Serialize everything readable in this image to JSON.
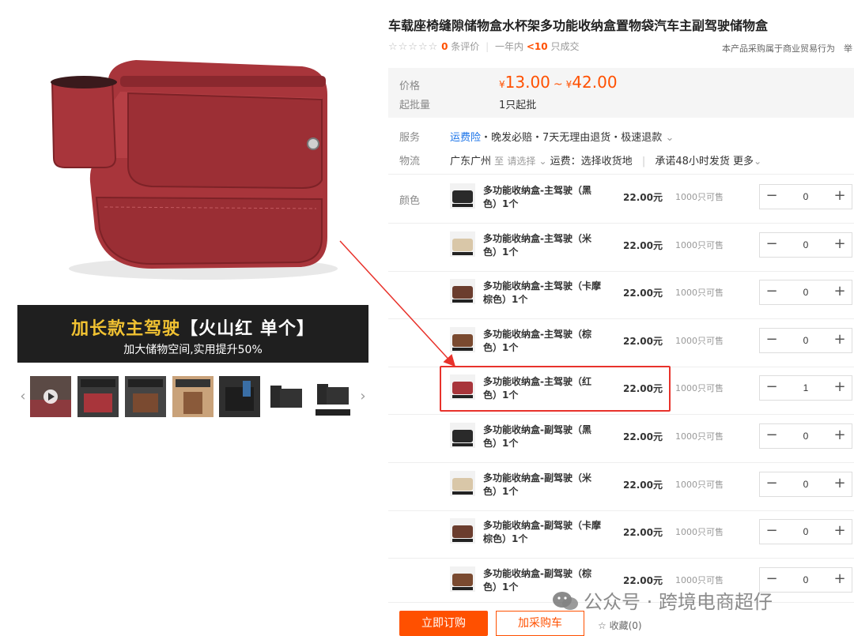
{
  "gallery": {
    "banner_title_main": "加长款主驾驶",
    "banner_title_tag": "【火山红 单个】",
    "banner_subtitle": "加大储物空间,实用提升50%",
    "thumb_prev_icon": "chevron-left-icon",
    "thumb_next_icon": "chevron-right-icon",
    "product_color": "#a8353b"
  },
  "product": {
    "title": "车载座椅缝隙储物盒水杯架多功能收纳盒置物袋汽车主副驾驶储物盒",
    "stars": "☆☆☆☆☆",
    "review_count": "0",
    "review_suffix": "条评价",
    "sales_prefix": "一年内",
    "sales_count": "<10",
    "sales_suffix": "只成交",
    "business_note": "本产品采购属于商业贸易行为",
    "business_note_tail": "举"
  },
  "pricing": {
    "price_label": "价格",
    "currency": "¥",
    "price_min": "13.00",
    "tilde": "~",
    "price_max": "42.00",
    "moq_label": "起批量",
    "moq_value": "1只起批"
  },
  "service": {
    "label": "服务",
    "insurance_link": "运费险",
    "items": "・晚发必赔・7天无理由退货・极速退款",
    "chevron": "⌄"
  },
  "logistics": {
    "label": "物流",
    "origin": "广东广州",
    "to": "至",
    "select": "请选择",
    "freight": "运费：选择收货地",
    "promise": "承诺48小时发货",
    "more": "更多"
  },
  "sku": {
    "label": "颜色",
    "minus": "−",
    "plus": "+",
    "items": [
      {
        "name": "多功能收纳盒-主驾驶（黑色）1个",
        "price": "22.00元",
        "stock": "1000只可售",
        "qty": "0",
        "color": "#2a2a2a"
      },
      {
        "name": "多功能收纳盒-主驾驶（米色）1个",
        "price": "22.00元",
        "stock": "1000只可售",
        "qty": "0",
        "color": "#d9c7a8"
      },
      {
        "name": "多功能收纳盒-主驾驶（卡摩棕色）1个",
        "price": "22.00元",
        "stock": "1000只可售",
        "qty": "0",
        "color": "#6b3d2e"
      },
      {
        "name": "多功能收纳盒-主驾驶（棕色）1个",
        "price": "22.00元",
        "stock": "1000只可售",
        "qty": "0",
        "color": "#7a4a30"
      },
      {
        "name": "多功能收纳盒-主驾驶（红色）1个",
        "price": "22.00元",
        "stock": "1000只可售",
        "qty": "1",
        "color": "#a8353b"
      },
      {
        "name": "多功能收纳盒-副驾驶（黑色）1个",
        "price": "22.00元",
        "stock": "1000只可售",
        "qty": "0",
        "color": "#2a2a2a"
      },
      {
        "name": "多功能收纳盒-副驾驶（米色）1个",
        "price": "22.00元",
        "stock": "1000只可售",
        "qty": "0",
        "color": "#d9c7a8"
      },
      {
        "name": "多功能收纳盒-副驾驶（卡摩棕色）1个",
        "price": "22.00元",
        "stock": "1000只可售",
        "qty": "0",
        "color": "#6b3d2e"
      },
      {
        "name": "多功能收纳盒-副驾驶（棕色）1个",
        "price": "22.00元",
        "stock": "1000只可售",
        "qty": "0",
        "color": "#7a4a30"
      }
    ]
  },
  "actions": {
    "buy_now": "立即订购",
    "add_cart": "加采购车",
    "favorite": "☆ 收藏(0)"
  },
  "watermark": {
    "text": "公众号 · 跨境电商超仔",
    "icon": "wechat-icon"
  },
  "colors": {
    "accent": "#ff5000",
    "highlight": "#e8322b",
    "link": "#1a73e8"
  }
}
